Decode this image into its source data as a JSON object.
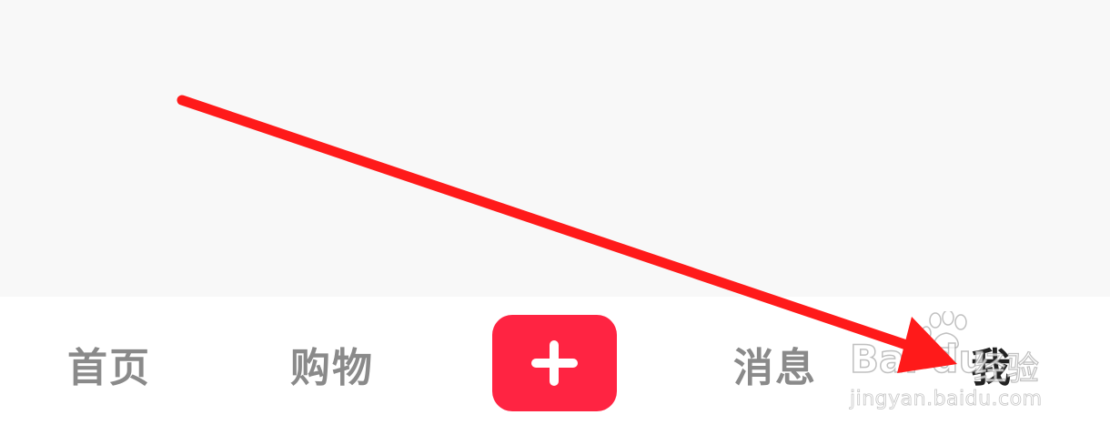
{
  "tab_bar": {
    "tabs": [
      {
        "id": "home",
        "label": "首页",
        "active": false
      },
      {
        "id": "shop",
        "label": "购物",
        "active": false
      },
      {
        "id": "publish",
        "label": "",
        "icon": "plus-icon"
      },
      {
        "id": "messages",
        "label": "消息",
        "active": false
      },
      {
        "id": "me",
        "label": "我",
        "active": true
      }
    ],
    "publish_button_color": "#ff2442"
  },
  "watermark": {
    "brand": "Bai du",
    "suffix": "经验",
    "url": "jingyan.baidu.com"
  },
  "annotation": {
    "arrow_color": "#ff1a1a"
  }
}
